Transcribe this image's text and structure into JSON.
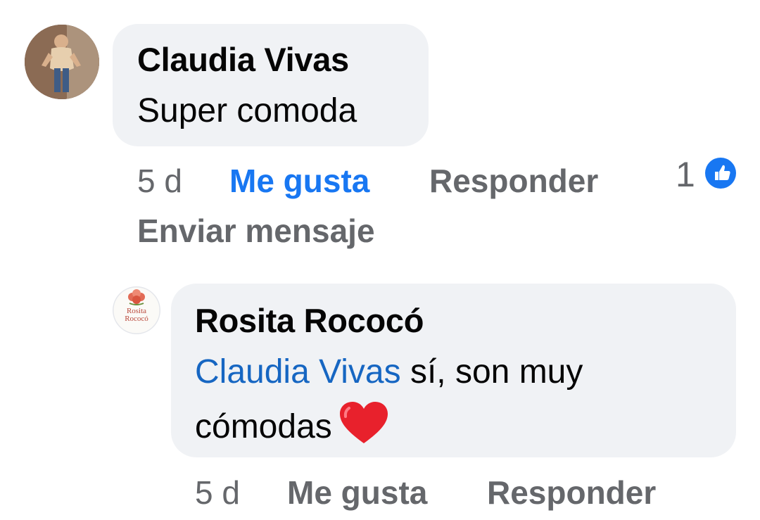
{
  "comment": {
    "author": "Claudia Vivas",
    "text": "Super comoda",
    "time": "5 d",
    "like_label": "Me gusta",
    "reply_label": "Responder",
    "reaction_count": "1",
    "message_label": "Enviar mensaje",
    "avatar_icon": "user-avatar-photo"
  },
  "reply": {
    "author": "Rosita Rococó",
    "mention": "Claudia Vivas",
    "text_after_mention": " sí, son muy",
    "text_line2": "cómodas",
    "emoji": "heart-emoji",
    "time": "5 d",
    "like_label": "Me gusta",
    "reply_label": "Responder",
    "avatar_logo_text_line1": "Rosita",
    "avatar_logo_text_line2": "Rococó"
  },
  "colors": {
    "bubble": "#f0f2f5",
    "link": "#1666c2",
    "like_active": "#1877f2",
    "meta": "#65676b",
    "heart": "#e8212c"
  }
}
